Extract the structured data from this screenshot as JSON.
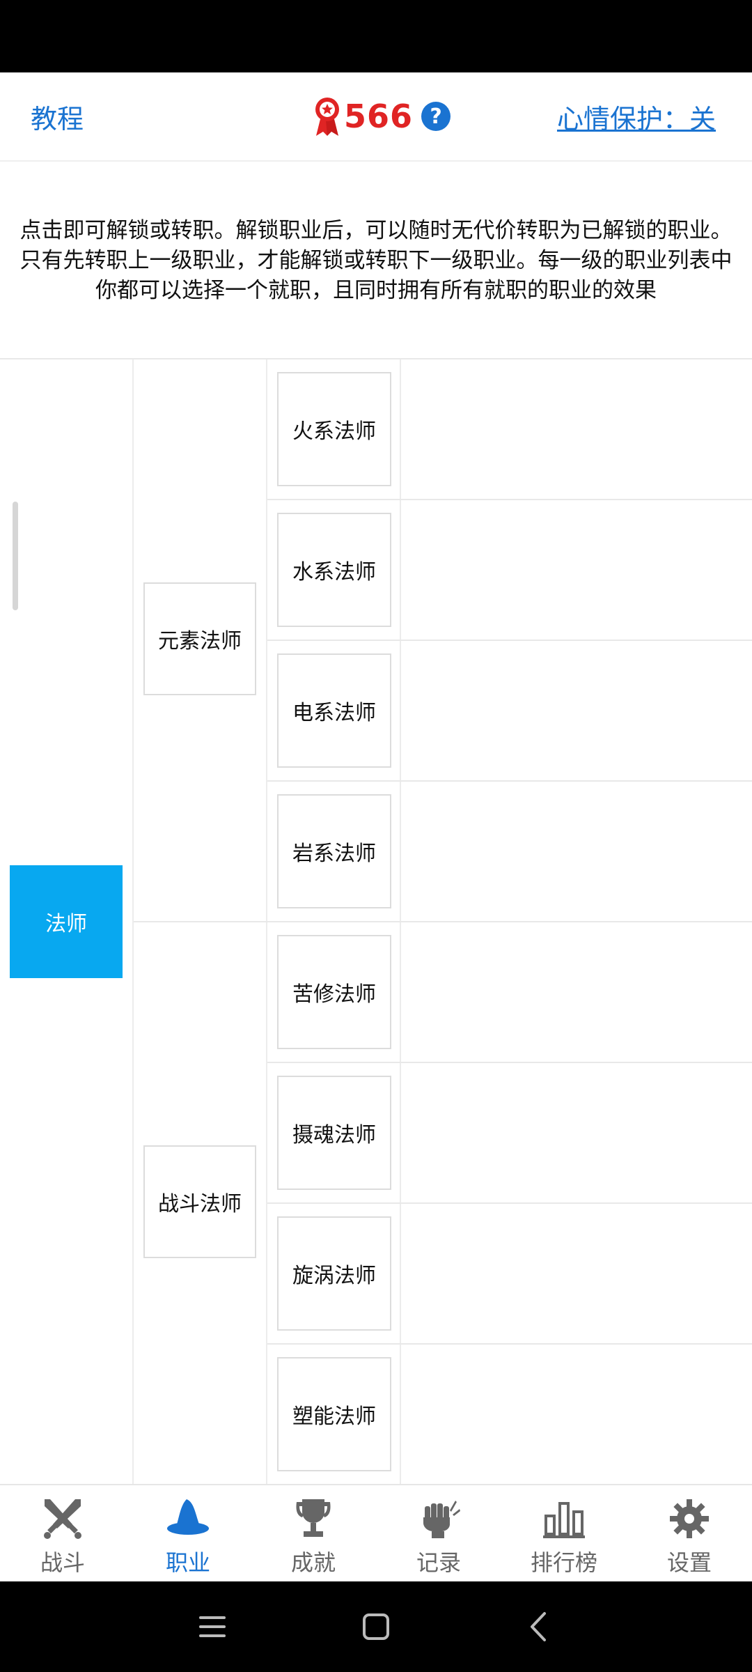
{
  "header": {
    "tutorial_label": "教程",
    "points_value": "566",
    "help_label": "?",
    "mood_protect_label": "心情保护：关"
  },
  "description": "点击即可解锁或转职。解锁职业后，可以随时无代价转职为已解锁的职业。只有先转职上一级职业，才能解锁或转职下一级职业。每一级的职业列表中你都可以选择一个就职，且同时拥有所有就职的职业的效果",
  "tree": {
    "tier1": {
      "label": "法师",
      "selected": true
    },
    "tier2": [
      {
        "label": "元素法师",
        "children": [
          "火系法师",
          "水系法师",
          "电系法师",
          "岩系法师"
        ]
      },
      {
        "label": "战斗法师",
        "children": [
          "苦修法师",
          "摄魂法师",
          "旋涡法师",
          "塑能法师"
        ]
      }
    ]
  },
  "bottom_nav": [
    {
      "label": "战斗",
      "icon": "crossed-swords-icon",
      "active": false
    },
    {
      "label": "职业",
      "icon": "wizard-hat-icon",
      "active": true
    },
    {
      "label": "成就",
      "icon": "trophy-icon",
      "active": false
    },
    {
      "label": "记录",
      "icon": "fist-record-icon",
      "active": false
    },
    {
      "label": "排行榜",
      "icon": "leaderboard-bars-icon",
      "active": false
    },
    {
      "label": "设置",
      "icon": "gear-icon",
      "active": false
    }
  ],
  "colors": {
    "accent_blue": "#1a73d1",
    "selected_node": "#08a8f0",
    "points_red": "#e02424"
  }
}
